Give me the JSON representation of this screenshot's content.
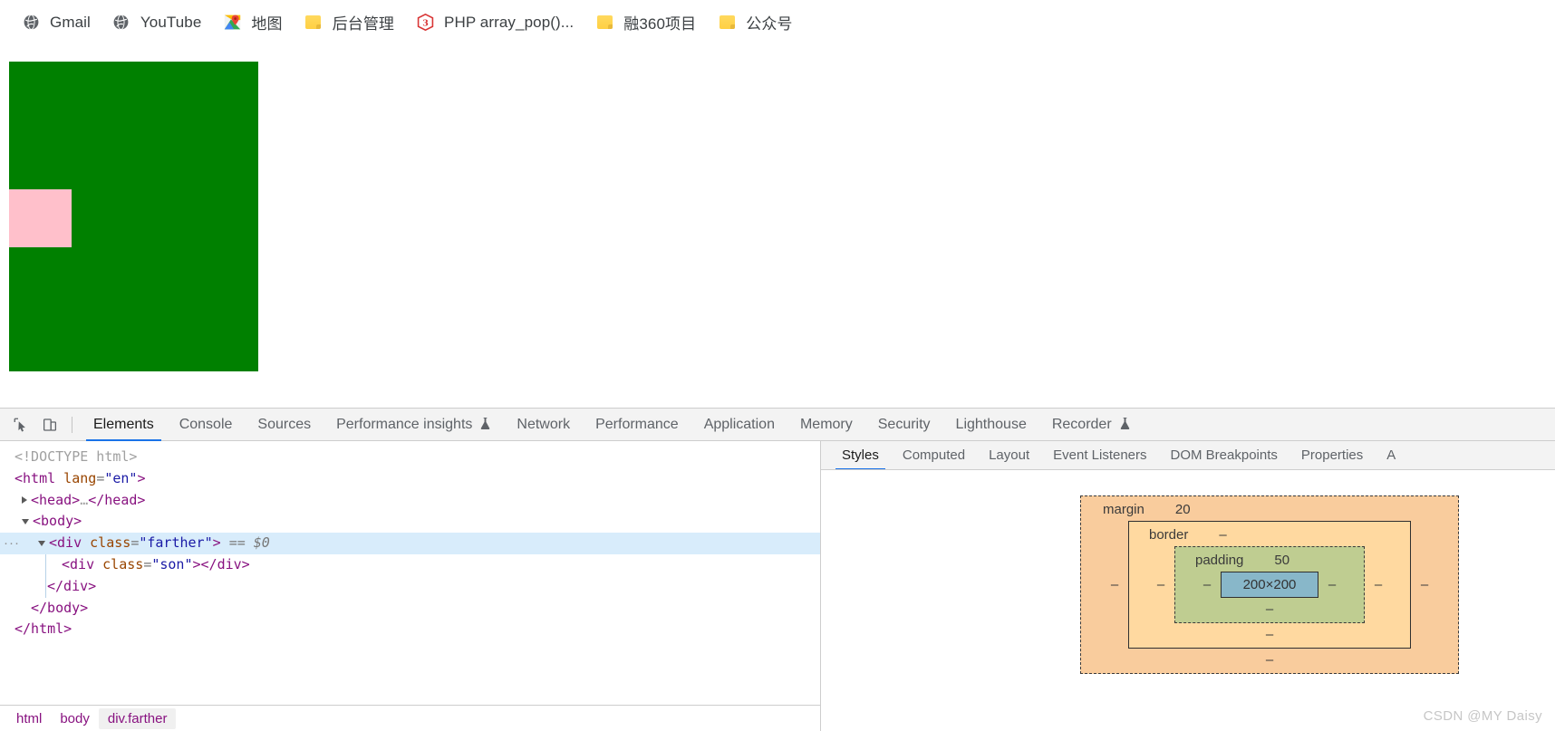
{
  "bookmarks_bar": {
    "items": [
      {
        "label": "Gmail",
        "icon": "globe-icon"
      },
      {
        "label": "YouTube",
        "icon": "globe-icon"
      },
      {
        "label": "地图",
        "icon": "google-maps-icon"
      },
      {
        "label": "后台管理",
        "icon": "folder-icon"
      },
      {
        "label": "PHP array_pop()...",
        "icon": "php-icon"
      },
      {
        "label": "融360项目",
        "icon": "folder-icon"
      },
      {
        "label": "公众号",
        "icon": "folder-icon"
      }
    ]
  },
  "page": {
    "farther_box": {
      "class": "farther",
      "color": "#008000"
    },
    "son_box": {
      "class": "son",
      "color": "#ffc0cb"
    }
  },
  "devtools": {
    "toolbar": {
      "inspect_icon": "inspect-cursor-icon",
      "device_toggle_icon": "device-toolbar-icon"
    },
    "tabs": [
      {
        "label": "Elements",
        "active": true,
        "badge": ""
      },
      {
        "label": "Console",
        "active": false,
        "badge": ""
      },
      {
        "label": "Sources",
        "active": false,
        "badge": ""
      },
      {
        "label": "Performance insights",
        "active": false,
        "badge": "⚗"
      },
      {
        "label": "Network",
        "active": false,
        "badge": ""
      },
      {
        "label": "Performance",
        "active": false,
        "badge": ""
      },
      {
        "label": "Application",
        "active": false,
        "badge": ""
      },
      {
        "label": "Memory",
        "active": false,
        "badge": ""
      },
      {
        "label": "Security",
        "active": false,
        "badge": ""
      },
      {
        "label": "Lighthouse",
        "active": false,
        "badge": ""
      },
      {
        "label": "Recorder",
        "active": false,
        "badge": "⚗"
      }
    ],
    "dom_tree": {
      "lines": [
        {
          "doctype": "<!DOCTYPE html>"
        },
        {
          "tag_open": "<html",
          "attr": " lang",
          "eq": "=",
          "val": "\"en\"",
          "tag_close": ">"
        },
        {
          "twisty": "right",
          "tag_open": "<head>",
          "ellipsis": "…",
          "tag_close": "</head>"
        },
        {
          "twisty": "down",
          "tag_open": "<body>"
        },
        {
          "twisty": "down",
          "tag_open": "<div",
          "attr": " class",
          "eq": "=",
          "val": "\"farther\"",
          "tag_close": ">",
          "selection": "== $0",
          "selected": true,
          "dots": "···"
        },
        {
          "tag_open": "<div",
          "attr": " class",
          "eq": "=",
          "val": "\"son\"",
          "tag_close": "></div>"
        },
        {
          "tag_open": "</div>"
        },
        {
          "tag_open": "</body>"
        },
        {
          "tag_open": "</html>"
        }
      ]
    },
    "breadcrumb": [
      {
        "label": "html",
        "active": false
      },
      {
        "label": "body",
        "active": false
      },
      {
        "label": "div.farther",
        "active": true
      }
    ],
    "styles_tabs": [
      {
        "label": "Styles",
        "active": true
      },
      {
        "label": "Computed",
        "active": false
      },
      {
        "label": "Layout",
        "active": false
      },
      {
        "label": "Event Listeners",
        "active": false
      },
      {
        "label": "DOM Breakpoints",
        "active": false
      },
      {
        "label": "Properties",
        "active": false
      },
      {
        "label": "A",
        "active": false
      }
    ],
    "box_model": {
      "margin": {
        "label": "margin",
        "top": "20",
        "right": "–",
        "bottom": "–",
        "left": "–",
        "color": "#f9cc9d"
      },
      "border": {
        "label": "border",
        "top": "–",
        "right": "–",
        "bottom": "–",
        "left": "–",
        "color": "#ffd9a0"
      },
      "padding": {
        "label": "padding",
        "top": "50",
        "right": "–",
        "bottom": "–",
        "left": "–",
        "color": "#bfcd91"
      },
      "content": {
        "size": "200×200",
        "color": "#88b7c9"
      }
    }
  },
  "watermark": "CSDN @MY Daisy"
}
